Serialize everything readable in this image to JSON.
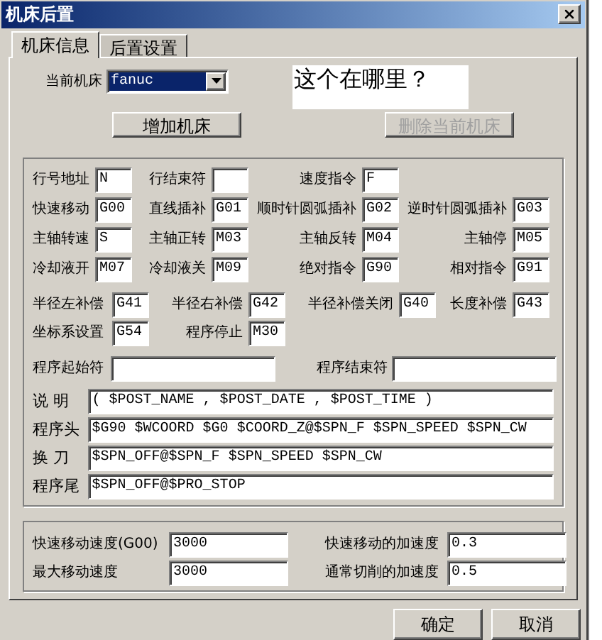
{
  "window": {
    "title": "机床后置"
  },
  "tabs": [
    {
      "label": "机床信息",
      "selected": true
    },
    {
      "label": "后置设置",
      "selected": false
    }
  ],
  "current_machine": {
    "label": "当前机床",
    "value": "fanuc"
  },
  "machine_buttons": [
    {
      "label": "增加机床",
      "disabled": false
    },
    {
      "label": "删除当前机床",
      "disabled": true
    }
  ],
  "annotation": {
    "text": "这个在哪里？"
  },
  "code_rows": [
    [
      {
        "label": "行号地址",
        "value": "N"
      },
      {
        "label": "行结束符"
      },
      {
        "label": "速度指令",
        "value": "F"
      }
    ],
    [
      {
        "label": "快速移动",
        "value": "G00"
      },
      {
        "label": "直线插补",
        "value": "G01"
      },
      {
        "label": "顺时针圆弧插补",
        "value": "G02"
      },
      {
        "label": "逆时针圆弧插补",
        "value": "G03"
      }
    ],
    [
      {
        "label": "主轴转速",
        "value": "S"
      },
      {
        "label": "主轴正转",
        "value": "M03"
      },
      {
        "label": "主轴反转",
        "value": "M04"
      },
      {
        "label": "主轴停",
        "value": "M05"
      }
    ],
    [
      {
        "label": "冷却液开",
        "value": "M07"
      },
      {
        "label": "冷却液关",
        "value": "M09"
      },
      {
        "label": "绝对指令",
        "value": "G90"
      },
      {
        "label": "相对指令",
        "value": "G91"
      }
    ]
  ],
  "comp_rows": [
    [
      {
        "label": "半径左补偿",
        "value": "G41"
      },
      {
        "label": "半径右补偿",
        "value": "G42"
      },
      {
        "label": "半径补偿关闭",
        "value": "G40"
      },
      {
        "label": "长度补偿",
        "value": "G43"
      }
    ],
    [
      {
        "label": "坐标系设置",
        "value": "G54"
      },
      {
        "label": "程序停止",
        "value": "M30"
      }
    ]
  ],
  "program_markers": [
    {
      "label": "程序起始符"
    },
    {
      "label": "程序结束符"
    }
  ],
  "program_lines": [
    {
      "label": "说 明",
      "value": "( $POST_NAME , $POST_DATE , $POST_TIME )"
    },
    {
      "label": "程序头",
      "value": "$G90 $WCOORD $G0 $COORD_Z@$SPN_F $SPN_SPEED $SPN_CW"
    },
    {
      "label": "换 刀",
      "value": "$SPN_OFF@$SPN_F $SPN_SPEED $SPN_CW"
    },
    {
      "label": "程序尾",
      "value": "$SPN_OFF@$PRO_STOP"
    }
  ],
  "speeds": [
    {
      "label": "快速移动速度(G00)",
      "value": "3000"
    },
    {
      "label": "快速移动的加速度",
      "value": "0.3"
    },
    {
      "label": "最大移动速度",
      "value": "3000"
    },
    {
      "label": "通常切削的加速度",
      "value": "0.5"
    }
  ],
  "buttons": [
    "确定",
    "取消"
  ]
}
